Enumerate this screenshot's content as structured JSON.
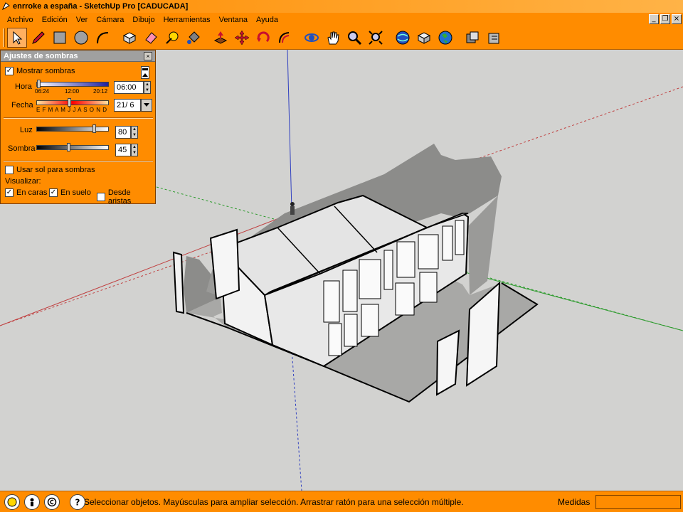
{
  "window": {
    "title": "enrroke a españa - SketchUp Pro [CADUCADA]"
  },
  "menu": {
    "items": [
      "Archivo",
      "Edición",
      "Ver",
      "Cámara",
      "Dibujo",
      "Herramientas",
      "Ventana",
      "Ayuda"
    ]
  },
  "toolbar": {
    "tools": [
      "select-icon",
      "pencil-icon",
      "rectangle-icon",
      "circle-icon",
      "arc-icon",
      "make-component-icon",
      "eraser-icon",
      "tape-measure-icon",
      "paint-bucket-icon",
      "push-pull-icon",
      "move-icon",
      "rotate-icon",
      "offset-icon",
      "orbit-icon",
      "pan-icon",
      "zoom-icon",
      "zoom-extents-icon",
      "get-models-icon",
      "share-model-icon",
      "share-component-icon",
      "google-earth-icon",
      "component-icon"
    ]
  },
  "shadow_dialog": {
    "title": "Ajustes de sombras",
    "show_shadows_label": "Mostrar sombras",
    "show_shadows": true,
    "time_label": "Hora",
    "time_min": "06:24",
    "time_mid": "12:00",
    "time_max": "20:12",
    "time_value": "06:00",
    "date_label": "Fecha",
    "months": "E F M A M J J A S O N D",
    "date_value": "21/ 6",
    "light_label": "Luz",
    "light_value": "80",
    "shadow_label": "Sombra",
    "shadow_value": "45",
    "use_sun_label": "Usar sol para sombras",
    "use_sun": false,
    "display_label": "Visualizar:",
    "on_faces_label": "En caras",
    "on_faces": true,
    "on_ground_label": "En suelo",
    "on_ground": true,
    "from_edges_label": "Desde aristas",
    "from_edges": false
  },
  "status": {
    "text": "Seleccionar objetos. Mayúsculas para ampliar selección. Arrastrar ratón para una selección múltiple.",
    "measure_label": "Medidas",
    "measure_value": ""
  },
  "colors": {
    "accent": "#ff8c00",
    "viewport": "#d2d2d0"
  }
}
